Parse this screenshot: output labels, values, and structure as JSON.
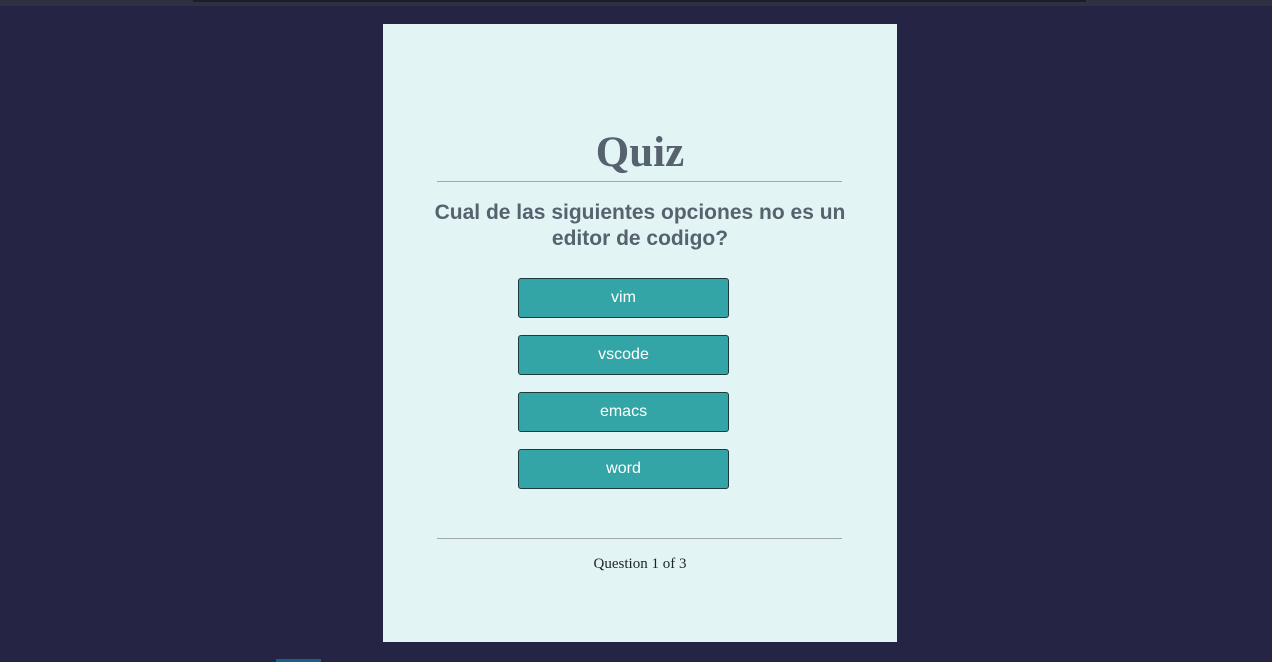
{
  "quiz": {
    "title": "Quiz",
    "question": "Cual de las siguientes opciones no es un editor de codigo?",
    "options": [
      {
        "label": "vim"
      },
      {
        "label": "vscode"
      },
      {
        "label": "emacs"
      },
      {
        "label": "word"
      }
    ],
    "progress": "Question 1 of 3"
  },
  "colors": {
    "background": "#262444",
    "card": "#e2f4f4",
    "button": "#34a5a6",
    "heading_text": "#56626e"
  }
}
